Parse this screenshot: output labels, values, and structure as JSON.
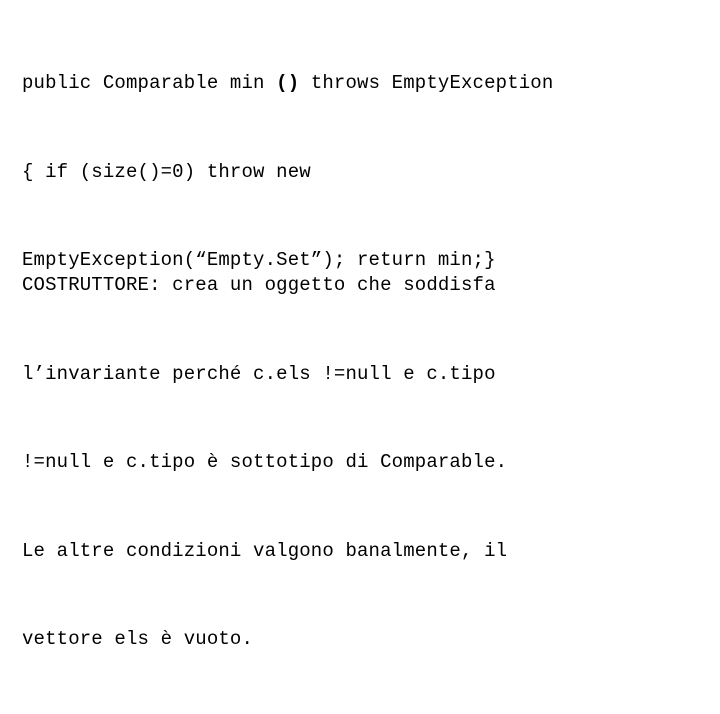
{
  "slide": {
    "background_color": "#ffffff",
    "text_color": "#000000",
    "code_block": {
      "lines": [
        {
          "segments": [
            {
              "text": "public Comparable min ",
              "bold": false
            },
            {
              "text": "()",
              "bold": true
            },
            {
              "text": " throws EmptyException",
              "bold": false
            }
          ],
          "plain": "public Comparable min () throws EmptyException"
        },
        {
          "segments": [
            {
              "text": "{ if (size()=0) throw new",
              "bold": false
            }
          ],
          "plain": "{ if (size()=0) throw new"
        },
        {
          "segments": [
            {
              "text": "EmptyException(“Empty.Set”); return min;}",
              "bold": false
            }
          ],
          "plain": "EmptyException(“Empty.Set”); return min;}"
        }
      ]
    },
    "description_block": {
      "lines": [
        "COSTRUTTORE: crea un oggetto che soddisfa",
        "l’invariante perché c.els !=null e c.tipo",
        "!=null e c.tipo è sottotipo di Comparable.",
        "Le altre condizioni valgono banalmente, il",
        "vettore els è vuoto."
      ]
    }
  }
}
